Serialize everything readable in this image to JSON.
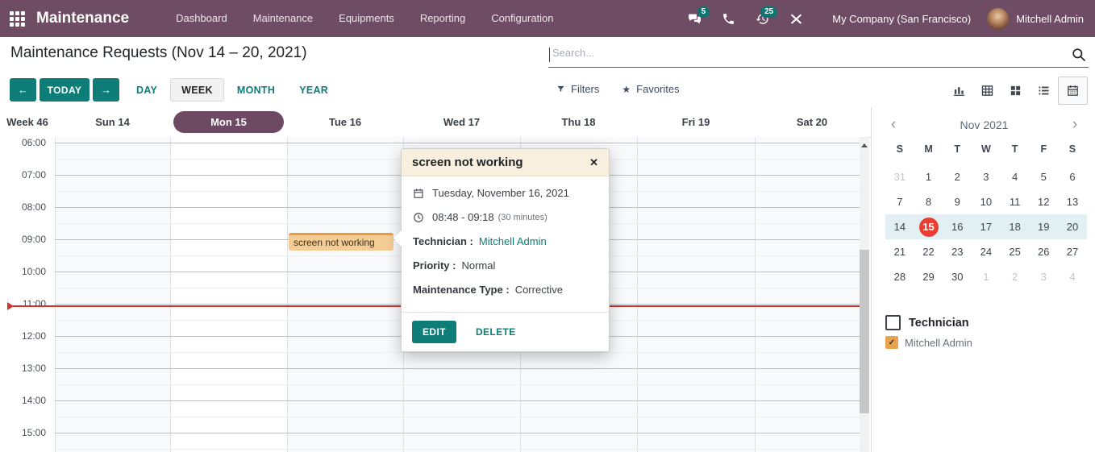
{
  "colors": {
    "nav_bg": "#6e4c63",
    "accent_teal": "#0e7d78",
    "badge_teal": "#0c756f",
    "pill_purple": "#6d4a62",
    "event_bg": "#f4cd96",
    "event_border": "#ea9c3e",
    "today_red": "#e93f33",
    "minical_highlight": "#e2eff3",
    "checkbox_orange": "#e9a24e",
    "popover_header_bg": "#f8efdf",
    "current_time_red": "#cf332b"
  },
  "nav": {
    "brand": "Maintenance",
    "menu": [
      "Dashboard",
      "Maintenance",
      "Equipments",
      "Reporting",
      "Configuration"
    ],
    "messages_badge": "5",
    "activities_badge": "25",
    "company": "My Company (San Francisco)",
    "user": "Mitchell Admin",
    "icons": [
      "apps-grid-icon",
      "chat-icon",
      "phone-icon",
      "activity-clock-icon",
      "tools-icon"
    ]
  },
  "header": {
    "title": "Maintenance Requests (Nov 14 – 20, 2021)"
  },
  "search": {
    "placeholder": "Search...",
    "icon": "search-icon"
  },
  "toolbar": {
    "prev_icon": "←",
    "today_label": "TODAY",
    "next_icon": "→",
    "scales": [
      "DAY",
      "WEEK",
      "MONTH",
      "YEAR"
    ],
    "active_scale": "WEEK",
    "filters_label": "Filters",
    "favorites_label": "Favorites",
    "favorites_star": "★",
    "views": [
      {
        "name": "graph",
        "active": false
      },
      {
        "name": "pivot",
        "active": false
      },
      {
        "name": "kanban",
        "active": false
      },
      {
        "name": "list",
        "active": false
      },
      {
        "name": "calendar",
        "active": true
      }
    ]
  },
  "week_header": {
    "week_label": "Week 46",
    "days": [
      {
        "label": "Sun 14",
        "selected": false
      },
      {
        "label": "Mon 15",
        "selected": true
      },
      {
        "label": "Tue 16",
        "selected": false
      },
      {
        "label": "Wed 17",
        "selected": false
      },
      {
        "label": "Thu 18",
        "selected": false
      },
      {
        "label": "Fri 19",
        "selected": false
      },
      {
        "label": "Sat 20",
        "selected": false
      }
    ]
  },
  "time_grid": {
    "hours": [
      "06:00",
      "07:00",
      "08:00",
      "09:00",
      "10:00",
      "11:00",
      "12:00",
      "13:00",
      "14:00",
      "15:00"
    ],
    "event": {
      "title": "screen not working",
      "day": "Tue 16",
      "start": "08:48",
      "end": "09:18"
    },
    "current_time": "11:00"
  },
  "popover": {
    "title": "screen not working",
    "close_icon": "✕",
    "date": "Tuesday, November 16, 2021",
    "time_range": "08:48 - 09:18",
    "duration": "(30 minutes)",
    "technician_label": "Technician :",
    "technician_value": "Mitchell Admin",
    "priority_label": "Priority :",
    "priority_value": "Normal",
    "type_label": "Maintenance Type :",
    "type_value": "Corrective",
    "edit_label": "EDIT",
    "delete_label": "DELETE"
  },
  "mini_calendar": {
    "title": "Nov 2021",
    "prev_icon": "‹",
    "next_icon": "›",
    "dow": [
      "S",
      "M",
      "T",
      "W",
      "T",
      "F",
      "S"
    ],
    "rows": [
      [
        {
          "t": "31",
          "muted": true
        },
        {
          "t": "1"
        },
        {
          "t": "2"
        },
        {
          "t": "3"
        },
        {
          "t": "4"
        },
        {
          "t": "5"
        },
        {
          "t": "6"
        }
      ],
      [
        {
          "t": "7"
        },
        {
          "t": "8"
        },
        {
          "t": "9"
        },
        {
          "t": "10"
        },
        {
          "t": "11"
        },
        {
          "t": "12"
        },
        {
          "t": "13"
        }
      ],
      [
        {
          "t": "14"
        },
        {
          "t": "15",
          "today": true
        },
        {
          "t": "16"
        },
        {
          "t": "17"
        },
        {
          "t": "18"
        },
        {
          "t": "19"
        },
        {
          "t": "20"
        }
      ],
      [
        {
          "t": "21"
        },
        {
          "t": "22"
        },
        {
          "t": "23"
        },
        {
          "t": "24"
        },
        {
          "t": "25"
        },
        {
          "t": "26"
        },
        {
          "t": "27"
        }
      ],
      [
        {
          "t": "28"
        },
        {
          "t": "29"
        },
        {
          "t": "30"
        },
        {
          "t": "1",
          "muted": true
        },
        {
          "t": "2",
          "muted": true
        },
        {
          "t": "3",
          "muted": true
        },
        {
          "t": "4",
          "muted": true
        }
      ]
    ],
    "highlight_row": 2
  },
  "filters_panel": {
    "group_label": "Technician",
    "check_glyph": "✓",
    "items": [
      {
        "label": "Mitchell Admin",
        "checked": true,
        "color": "#e9a24e"
      }
    ]
  }
}
